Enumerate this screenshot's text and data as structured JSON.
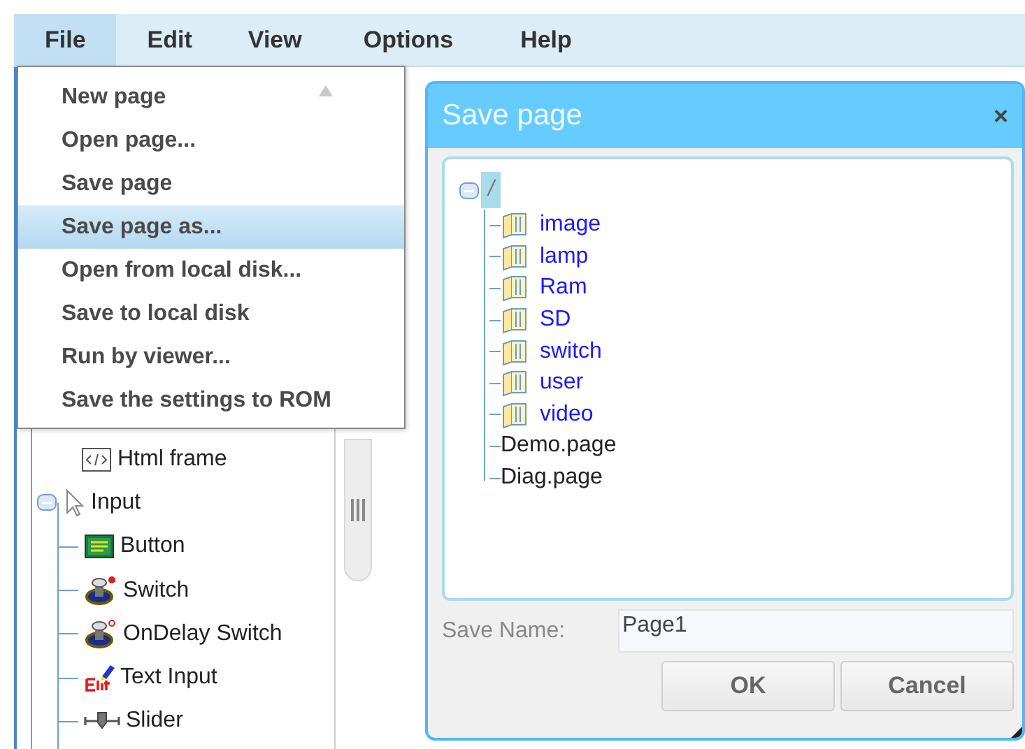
{
  "menubar": {
    "items": [
      {
        "label": "File",
        "selected": true
      },
      {
        "label": "Edit",
        "selected": false
      },
      {
        "label": "View",
        "selected": false
      },
      {
        "label": "Options",
        "selected": false
      },
      {
        "label": "Help",
        "selected": false
      }
    ]
  },
  "file_menu": {
    "items": [
      {
        "label": "New page",
        "selected": false
      },
      {
        "label": "Open page...",
        "selected": false
      },
      {
        "label": "Save page",
        "selected": false
      },
      {
        "label": "Save page as...",
        "selected": true
      },
      {
        "label": "Open from local disk...",
        "selected": false
      },
      {
        "label": "Save to local disk",
        "selected": false
      },
      {
        "label": "Run by viewer...",
        "selected": false
      },
      {
        "label": "Save the settings to ROM",
        "selected": false
      }
    ]
  },
  "component_tree": {
    "items": [
      {
        "label": "Html frame",
        "kind": "html"
      },
      {
        "label": "Input",
        "kind": "pointer",
        "expanded": true,
        "children": [
          {
            "label": "Button",
            "kind": "button"
          },
          {
            "label": "Switch",
            "kind": "switch"
          },
          {
            "label": "OnDelay Switch",
            "kind": "delay-switch"
          },
          {
            "label": "Text Input",
            "kind": "edit"
          },
          {
            "label": "Slider",
            "kind": "slider"
          }
        ]
      }
    ]
  },
  "dialog": {
    "title": "Save page",
    "close": "×",
    "tree": {
      "label": "/",
      "selected": true,
      "expanded": true,
      "children": [
        {
          "label": "image",
          "kind": "folder"
        },
        {
          "label": "lamp",
          "kind": "folder"
        },
        {
          "label": "Ram",
          "kind": "folder"
        },
        {
          "label": "SD",
          "kind": "folder"
        },
        {
          "label": "switch",
          "kind": "folder"
        },
        {
          "label": "user",
          "kind": "folder"
        },
        {
          "label": "video",
          "kind": "folder"
        },
        {
          "label": "Demo.page",
          "kind": "file"
        },
        {
          "label": "Diag.page",
          "kind": "file"
        }
      ]
    },
    "save_name_label": "Save Name:",
    "save_name_value": "Page1",
    "buttons": [
      "OK",
      "Cancel"
    ]
  }
}
